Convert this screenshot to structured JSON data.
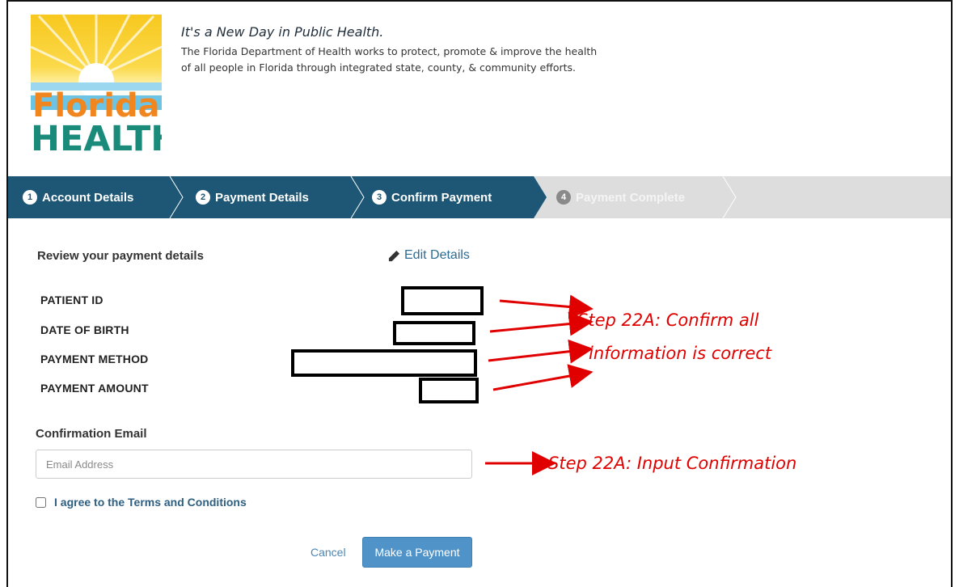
{
  "header": {
    "logo_text_line1": "Florida",
    "logo_text_line2": "HEALTH",
    "tagline": "It's a New Day in Public Health.",
    "mission": "The Florida Department of Health works to protect, promote & improve the health of all people in Florida through integrated state, county, & community efforts."
  },
  "stepper": {
    "steps": [
      {
        "num": "1",
        "label": "Account Details",
        "state": "complete"
      },
      {
        "num": "2",
        "label": "Payment Details",
        "state": "complete"
      },
      {
        "num": "3",
        "label": "Confirm Payment",
        "state": "active"
      },
      {
        "num": "4",
        "label": "Payment Complete",
        "state": "inactive"
      }
    ]
  },
  "review": {
    "title": "Review your payment details",
    "edit_label": "Edit Details",
    "fields": [
      {
        "label": "PATIENT ID"
      },
      {
        "label": "DATE OF BIRTH"
      },
      {
        "label": "PAYMENT METHOD"
      },
      {
        "label": "PAYMENT AMOUNT"
      }
    ]
  },
  "email": {
    "label": "Confirmation Email",
    "placeholder": "Email Address",
    "value": ""
  },
  "terms": {
    "label": "I agree to the Terms and Conditions",
    "checked": false
  },
  "actions": {
    "cancel_label": "Cancel",
    "pay_label": "Make a Payment"
  },
  "annotations": {
    "confirm_line1": "Step 22A: Confirm all",
    "confirm_line2": "information is correct",
    "input": "Step 22A: Input Confirmation"
  },
  "colors": {
    "stepper_active": "#1e5775",
    "stepper_inactive": "#dddddd",
    "primary_button": "#4f93c9",
    "annotation_red": "#e00000"
  }
}
